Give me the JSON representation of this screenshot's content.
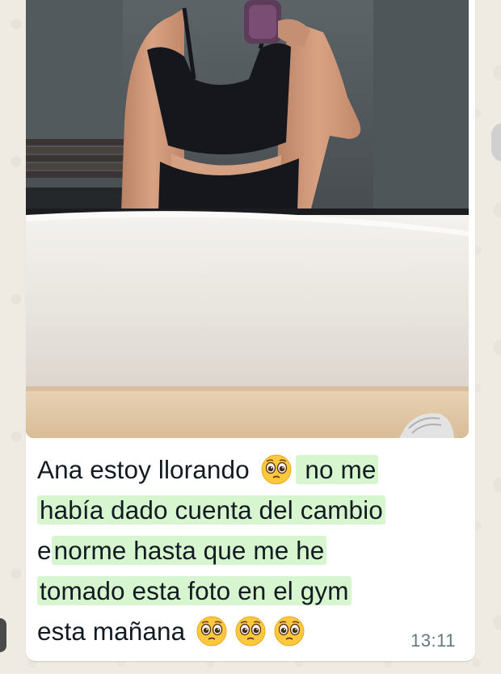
{
  "chat": {
    "message": {
      "image": "photo",
      "lines": [
        [
          "Ana estoy llorando ",
          " no me"
        ],
        [
          "había dado cuenta del cambio"
        ],
        [
          "e",
          "norme hasta que me he"
        ],
        [
          "tomado esta foto en el gym"
        ],
        [
          "esta mañana "
        ]
      ],
      "time": "13:11"
    }
  },
  "icons": {
    "emoji": "pleading-face-emoji"
  },
  "colors": {
    "bubble": "#ffffff",
    "wallpaper": "#efeae2",
    "highlight": "#d7f5cf",
    "timestamp": "#667781",
    "text": "#111b21"
  }
}
